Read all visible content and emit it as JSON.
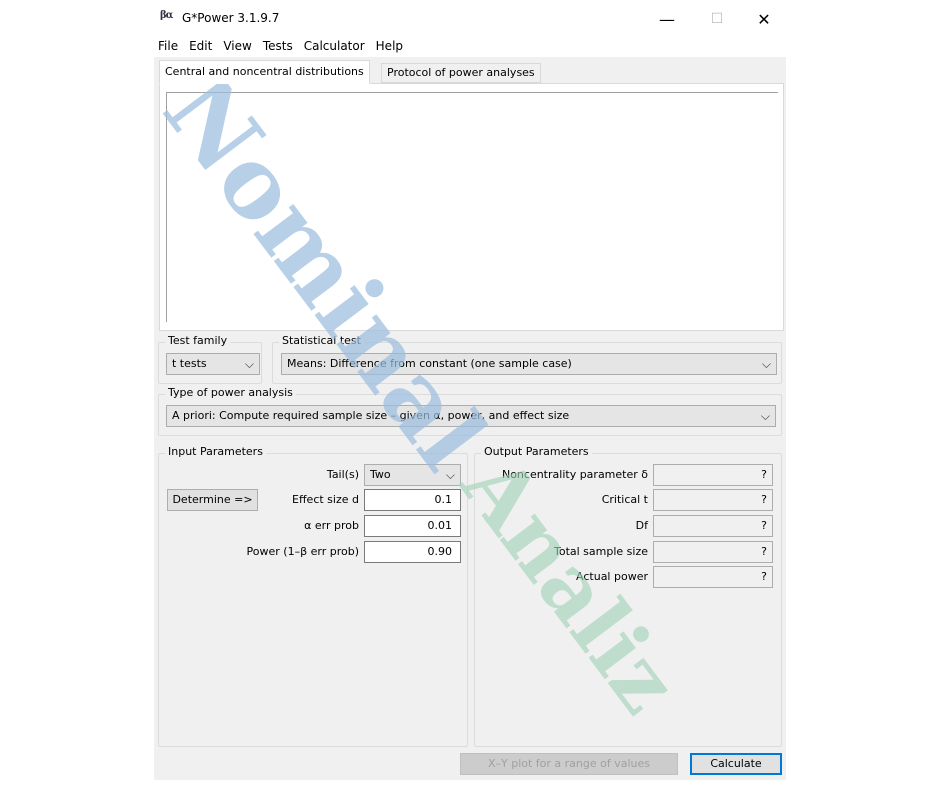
{
  "window": {
    "title": "G*Power 3.1.9.7",
    "icon_text": "βα",
    "controls": {
      "minimize": "—",
      "maximize": "☐",
      "close": "✕"
    }
  },
  "menu": [
    "File",
    "Edit",
    "View",
    "Tests",
    "Calculator",
    "Help"
  ],
  "tabs": [
    {
      "label": "Central and noncentral distributions",
      "active": true
    },
    {
      "label": "Protocol of power analyses",
      "active": false
    }
  ],
  "test_family": {
    "label": "Test family",
    "value": "t tests"
  },
  "statistical_test": {
    "label": "Statistical test",
    "value": "Means: Difference from constant (one sample case)"
  },
  "power_analysis": {
    "label": "Type of power analysis",
    "value": "A priori: Compute required sample size – given α, power, and effect size"
  },
  "input": {
    "title": "Input Parameters",
    "tails_label": "Tail(s)",
    "tails_value": "Two",
    "determine_label": "Determine =>",
    "effect_size_label": "Effect size d",
    "effect_size_value": "0.1",
    "alpha_label": "α err prob",
    "alpha_value": "0.01",
    "power_label": "Power (1–β err prob)",
    "power_value": "0.90"
  },
  "output": {
    "title": "Output Parameters",
    "rows": [
      {
        "label": "Noncentrality parameter δ",
        "value": "?"
      },
      {
        "label": "Critical t",
        "value": "?"
      },
      {
        "label": "Df",
        "value": "?"
      },
      {
        "label": "Total sample size",
        "value": "?"
      },
      {
        "label": "Actual power",
        "value": "?"
      }
    ]
  },
  "buttons": {
    "xy_plot": "X–Y plot for a range of values",
    "calculate": "Calculate"
  },
  "watermark": {
    "line1": "Nominal",
    "line2": "Analiz"
  },
  "colors": {
    "accent": "#0078d7",
    "watermark_blue": "#9bbede",
    "watermark_green": "#a0d2b6"
  }
}
